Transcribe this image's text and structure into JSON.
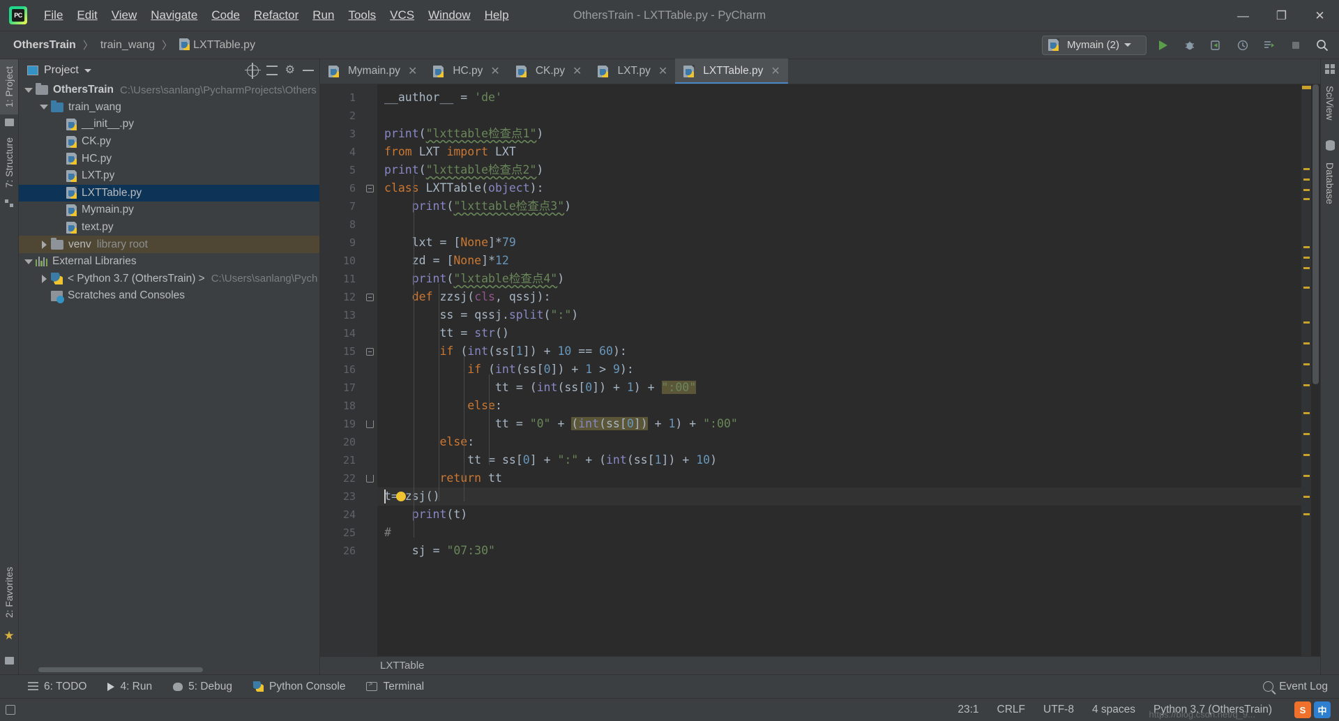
{
  "titlebar": {
    "logo_text": "PC",
    "window_title": "OthersTrain - LXTTable.py - PyCharm",
    "menus": [
      {
        "label": "File"
      },
      {
        "label": "Edit"
      },
      {
        "label": "View"
      },
      {
        "label": "Navigate"
      },
      {
        "label": "Code"
      },
      {
        "label": "Refactor"
      },
      {
        "label": "Run"
      },
      {
        "label": "Tools"
      },
      {
        "label": "VCS"
      },
      {
        "label": "Window"
      },
      {
        "label": "Help"
      }
    ],
    "minimize": "—",
    "maximize": "❐",
    "close": "✕"
  },
  "navbar": {
    "breadcrumbs": [
      "OthersTrain",
      "train_wang",
      "LXTTable.py"
    ],
    "separator": "〉",
    "run_config": "Mymain (2)"
  },
  "left_strip": {
    "project_tab": "1: Project",
    "structure_tab": "7: Structure",
    "favorites_tab": "2: Favorites"
  },
  "right_strip": {
    "sciview_tab": "SciView",
    "database_tab": "Database"
  },
  "project_panel": {
    "title": "Project",
    "tree": [
      {
        "indent": 0,
        "arrow": "down",
        "icon": "folder",
        "label": "OthersTrain",
        "bold": true,
        "path": "C:\\Users\\sanlang\\PycharmProjects\\Others",
        "state": "normal"
      },
      {
        "indent": 1,
        "arrow": "down",
        "icon": "folder-blue",
        "label": "train_wang",
        "bold": false,
        "path": "",
        "state": "normal"
      },
      {
        "indent": 2,
        "arrow": "none",
        "icon": "python-file",
        "label": "__init__.py",
        "bold": false,
        "path": "",
        "state": "normal"
      },
      {
        "indent": 2,
        "arrow": "none",
        "icon": "python-file",
        "label": "CK.py",
        "bold": false,
        "path": "",
        "state": "normal"
      },
      {
        "indent": 2,
        "arrow": "none",
        "icon": "python-file",
        "label": "HC.py",
        "bold": false,
        "path": "",
        "state": "normal"
      },
      {
        "indent": 2,
        "arrow": "none",
        "icon": "python-file",
        "label": "LXT.py",
        "bold": false,
        "path": "",
        "state": "normal"
      },
      {
        "indent": 2,
        "arrow": "none",
        "icon": "python-file",
        "label": "LXTTable.py",
        "bold": false,
        "path": "",
        "state": "selected"
      },
      {
        "indent": 2,
        "arrow": "none",
        "icon": "python-file",
        "label": "Mymain.py",
        "bold": false,
        "path": "",
        "state": "normal"
      },
      {
        "indent": 2,
        "arrow": "none",
        "icon": "python-file",
        "label": "text.py",
        "bold": false,
        "path": "",
        "state": "normal"
      },
      {
        "indent": 1,
        "arrow": "right",
        "icon": "folder",
        "label": "venv",
        "bold": false,
        "path": "library root",
        "state": "venv"
      },
      {
        "indent": 0,
        "arrow": "down",
        "icon": "libs",
        "label": "External Libraries",
        "bold": false,
        "path": "",
        "state": "normal"
      },
      {
        "indent": 1,
        "arrow": "right",
        "icon": "python-snake",
        "label": "< Python 3.7 (OthersTrain) >",
        "bold": false,
        "path": "C:\\Users\\sanlang\\Pych",
        "state": "normal"
      },
      {
        "indent": 1,
        "arrow": "none",
        "icon": "scratch",
        "label": "Scratches and Consoles",
        "bold": false,
        "path": "",
        "state": "normal"
      }
    ]
  },
  "editor": {
    "tabs": [
      {
        "label": "Mymain.py",
        "active": false
      },
      {
        "label": "HC.py",
        "active": false
      },
      {
        "label": "CK.py",
        "active": false
      },
      {
        "label": "LXT.py",
        "active": false
      },
      {
        "label": "LXTTable.py",
        "active": true
      }
    ],
    "close_glyph": "✕",
    "breadcrumb": "LXTTable",
    "line_numbers": [
      "1",
      "2",
      "3",
      "4",
      "5",
      "6",
      "7",
      "8",
      "9",
      "10",
      "11",
      "12",
      "13",
      "14",
      "15",
      "16",
      "17",
      "18",
      "19",
      "20",
      "21",
      "22",
      "23",
      "24",
      "25",
      "26"
    ],
    "code_lines": [
      "__author__ = 'de'",
      "",
      "print(\"lxttable检查点1\")",
      "from LXT import LXT",
      "print(\"lxttable检查点2\")",
      "class LXTTable(object):",
      "    print(\"lxttable检查点3\")",
      "",
      "    lxt = [None]*79",
      "    zd = [None]*12",
      "    print(\"lxtable检查点4\")",
      "    def zzsj(cls, qssj):",
      "        ss = qssj.split(\":\")",
      "        tt = str()",
      "        if (int(ss[1]) + 10 == 60):",
      "            if (int(ss[0]) + 1 > 9):",
      "                tt = (int(ss[0]) + 1) + \":00\"",
      "            else:",
      "                tt = \"0\" + (int(ss[0]) + 1) + \":00\"",
      "        else:",
      "            tt = ss[0] + \":\" + (int(ss[1]) + 10)",
      "        return tt",
      "t=zzsj()",
      "    print(t)",
      "#",
      "    sj = \"07:30\""
    ]
  },
  "bottom_toolwindows": [
    {
      "label": "6: TODO",
      "icon": "todo-icon"
    },
    {
      "label": "4: Run",
      "icon": "run-icon"
    },
    {
      "label": "5: Debug",
      "icon": "debug-icon"
    },
    {
      "label": "Python Console",
      "icon": "python-icon"
    },
    {
      "label": "Terminal",
      "icon": "terminal-icon"
    }
  ],
  "event_log": "Event Log",
  "statusbar": {
    "caret_position": "23:1",
    "line_separator": "CRLF",
    "encoding": "UTF-8",
    "indent": "4 spaces",
    "interpreter": "Python 3.7 (OthersTrain)",
    "watermark": "https://blog.csdn.net/q_9..."
  },
  "colors": {
    "accent_blue": "#4a88c7",
    "selection_blue": "#0d3456",
    "venv_brown": "#4f4733",
    "keyword_orange": "#cc7832",
    "string_green": "#6a8759",
    "number_blue": "#6897bb",
    "function_yellow": "#ffc66d",
    "highlight_olive": "#5a5637",
    "editor_bg": "#2b2b2b",
    "panel_bg": "#3c3f41"
  }
}
